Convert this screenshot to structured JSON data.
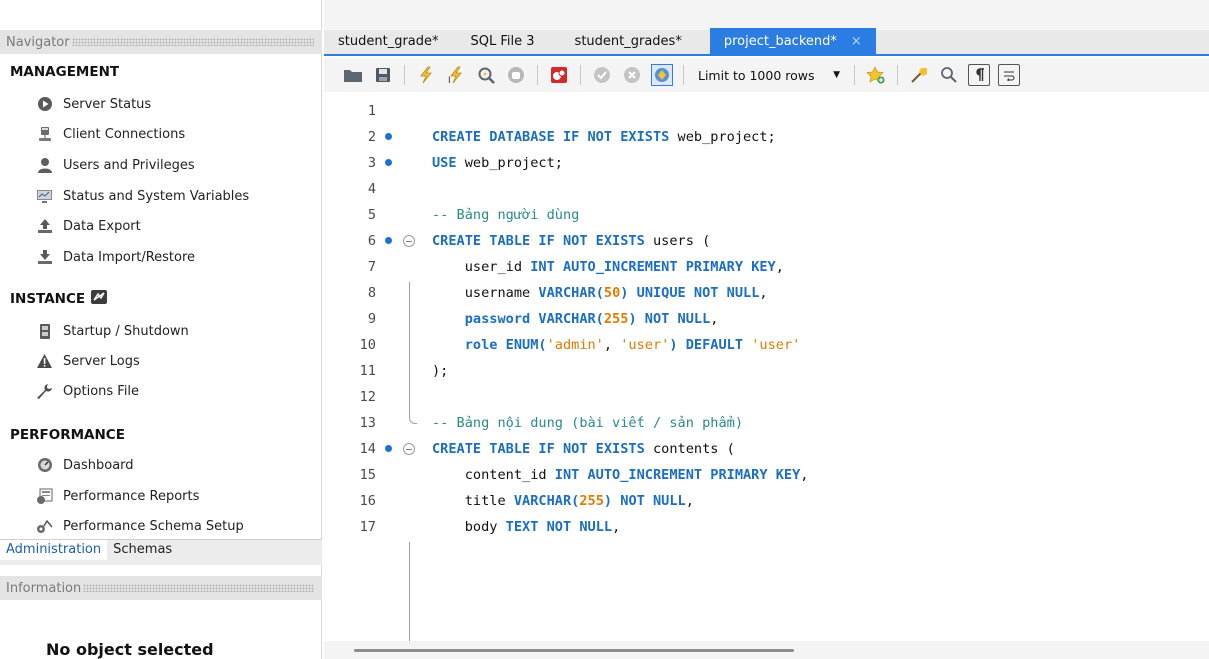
{
  "navigator": {
    "title": "Navigator",
    "management": {
      "title": "MANAGEMENT",
      "items": [
        {
          "label": "Server Status",
          "icon": "server-status-icon"
        },
        {
          "label": "Client Connections",
          "icon": "client-connections-icon"
        },
        {
          "label": "Users and Privileges",
          "icon": "user-icon"
        },
        {
          "label": "Status and System Variables",
          "icon": "monitor-icon"
        },
        {
          "label": "Data Export",
          "icon": "data-export-icon"
        },
        {
          "label": "Data Import/Restore",
          "icon": "data-import-icon"
        }
      ]
    },
    "instance": {
      "title": "INSTANCE",
      "items": [
        {
          "label": "Startup / Shutdown",
          "icon": "startup-icon"
        },
        {
          "label": "Server Logs",
          "icon": "warning-icon"
        },
        {
          "label": "Options File",
          "icon": "wrench-icon"
        }
      ]
    },
    "performance": {
      "title": "PERFORMANCE",
      "items": [
        {
          "label": "Dashboard",
          "icon": "dashboard-icon"
        },
        {
          "label": "Performance Reports",
          "icon": "reports-icon"
        },
        {
          "label": "Performance Schema Setup",
          "icon": "schema-setup-icon"
        }
      ]
    },
    "tabs": {
      "administration": "Administration",
      "schemas": "Schemas"
    }
  },
  "information": {
    "title": "Information",
    "message": "No object selected"
  },
  "editor": {
    "tabs": [
      {
        "label": "student_grade*",
        "active": false
      },
      {
        "label": "SQL File 3",
        "active": false
      },
      {
        "label": "student_grades*",
        "active": false
      },
      {
        "label": "project_backend*",
        "active": true
      }
    ],
    "close_glyph": "×",
    "toolbar": {
      "limit_label": "Limit to 1000 rows"
    },
    "colors": {
      "accent": "#2b7de1",
      "keyword": "#1b6ec2",
      "comment": "#2a8a8a",
      "literal": "#e07b00"
    },
    "lines": [
      {
        "n": "1",
        "dot": false,
        "fold": false,
        "tokens": []
      },
      {
        "n": "2",
        "dot": true,
        "fold": false,
        "tokens": [
          [
            "kw",
            "CREATE DATABASE IF NOT EXISTS"
          ],
          [
            "id",
            " web_project;"
          ]
        ]
      },
      {
        "n": "3",
        "dot": true,
        "fold": false,
        "tokens": [
          [
            "kw",
            "USE"
          ],
          [
            "id",
            " web_project;"
          ]
        ]
      },
      {
        "n": "4",
        "dot": false,
        "fold": false,
        "tokens": []
      },
      {
        "n": "5",
        "dot": false,
        "fold": false,
        "tokens": [
          [
            "cm",
            "-- Bảng người dùng"
          ]
        ]
      },
      {
        "n": "6",
        "dot": true,
        "fold": true,
        "tokens": [
          [
            "kw",
            "CREATE TABLE IF NOT EXISTS"
          ],
          [
            "id",
            " users ("
          ]
        ]
      },
      {
        "n": "7",
        "dot": false,
        "fold": false,
        "tokens": [
          [
            "id",
            "    user_id "
          ],
          [
            "kw",
            "INT AUTO_INCREMENT PRIMARY KEY"
          ],
          [
            "id",
            ","
          ]
        ]
      },
      {
        "n": "8",
        "dot": false,
        "fold": false,
        "tokens": [
          [
            "id",
            "    username "
          ],
          [
            "kw",
            "VARCHAR("
          ],
          [
            "num",
            "50"
          ],
          [
            "kw",
            ") UNIQUE NOT NULL"
          ],
          [
            "id",
            ","
          ]
        ]
      },
      {
        "n": "9",
        "dot": false,
        "fold": false,
        "tokens": [
          [
            "kw",
            "    password VARCHAR("
          ],
          [
            "num",
            "255"
          ],
          [
            "kw",
            ") NOT NULL"
          ],
          [
            "id",
            ","
          ]
        ]
      },
      {
        "n": "10",
        "dot": false,
        "fold": false,
        "tokens": [
          [
            "kw",
            "    role ENUM("
          ],
          [
            "str",
            "'admin'"
          ],
          [
            "id",
            ", "
          ],
          [
            "str",
            "'user'"
          ],
          [
            "kw",
            ") DEFAULT "
          ],
          [
            "str",
            "'user'"
          ]
        ]
      },
      {
        "n": "11",
        "dot": false,
        "fold": false,
        "tokens": [
          [
            "id",
            ");"
          ]
        ]
      },
      {
        "n": "12",
        "dot": false,
        "fold": false,
        "tokens": []
      },
      {
        "n": "13",
        "dot": false,
        "fold": false,
        "tokens": [
          [
            "cm",
            "-- Bảng nội dung (bài viết / sản phẩm)"
          ]
        ]
      },
      {
        "n": "14",
        "dot": true,
        "fold": true,
        "tokens": [
          [
            "kw",
            "CREATE TABLE IF NOT EXISTS"
          ],
          [
            "id",
            " contents ("
          ]
        ]
      },
      {
        "n": "15",
        "dot": false,
        "fold": false,
        "tokens": [
          [
            "id",
            "    content_id "
          ],
          [
            "kw",
            "INT AUTO_INCREMENT PRIMARY KEY"
          ],
          [
            "id",
            ","
          ]
        ]
      },
      {
        "n": "16",
        "dot": false,
        "fold": false,
        "tokens": [
          [
            "id",
            "    title "
          ],
          [
            "kw",
            "VARCHAR("
          ],
          [
            "num",
            "255"
          ],
          [
            "kw",
            ") NOT NULL"
          ],
          [
            "id",
            ","
          ]
        ]
      },
      {
        "n": "17",
        "dot": false,
        "fold": false,
        "tokens": [
          [
            "id",
            "    body "
          ],
          [
            "kw",
            "TEXT NOT NULL"
          ],
          [
            "id",
            ","
          ]
        ]
      }
    ]
  }
}
